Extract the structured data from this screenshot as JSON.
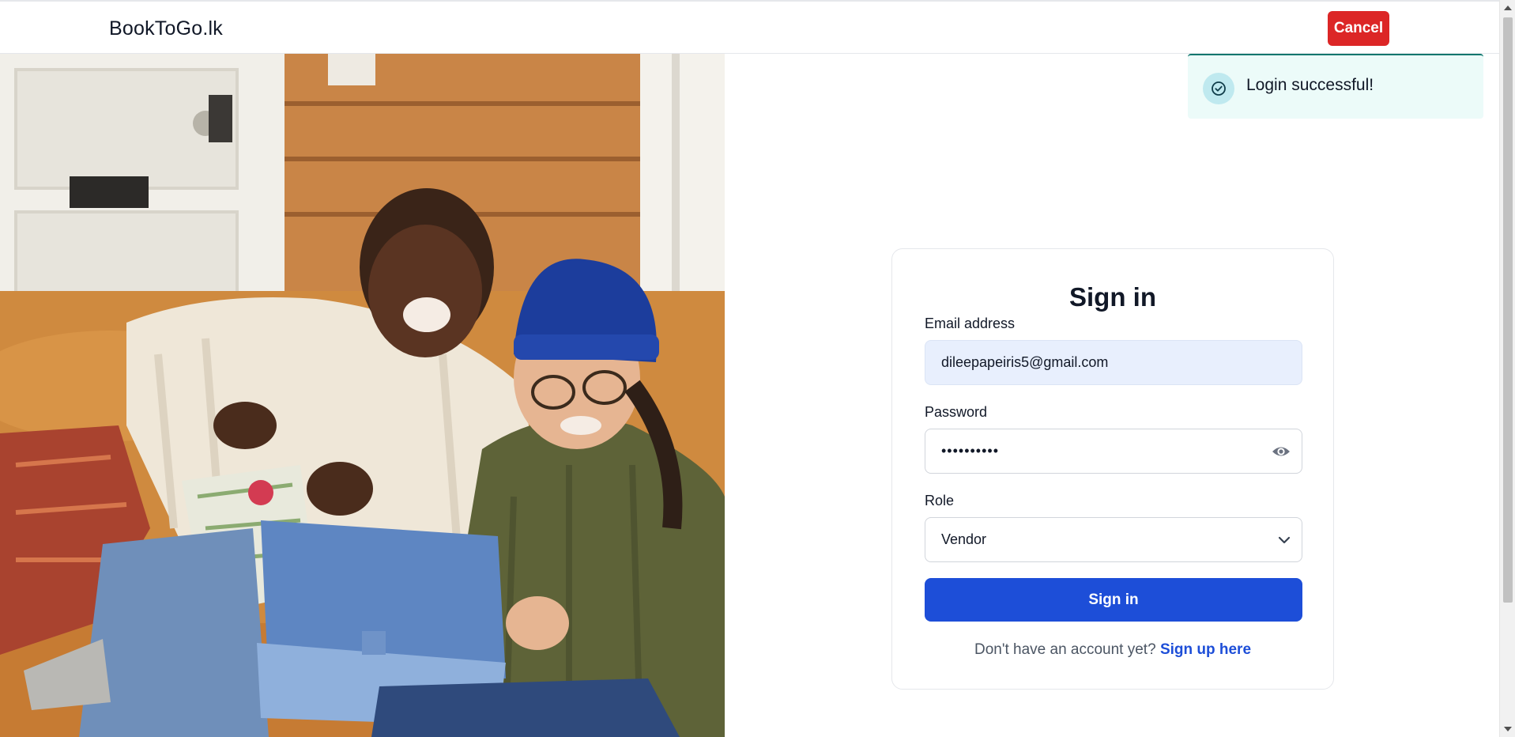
{
  "header": {
    "brand": "BookToGo.lk",
    "cancel_label": "Cancel"
  },
  "toast": {
    "message": "Login successful!",
    "icon": "check-circle-icon"
  },
  "form": {
    "title": "Sign in",
    "email_label": "Email address",
    "email_value": "dileepapeiris5@gmail.com",
    "password_label": "Password",
    "password_value": "••••••••••",
    "role_label": "Role",
    "role_value": "Vendor",
    "submit_label": "Sign in",
    "footer_text": "Don't have an account yet?",
    "signup_link": "Sign up here"
  },
  "colors": {
    "primary": "#1d4ed8",
    "danger": "#dc2626",
    "toast_bg": "#ecfbf9",
    "toast_accent": "#0f766e"
  }
}
